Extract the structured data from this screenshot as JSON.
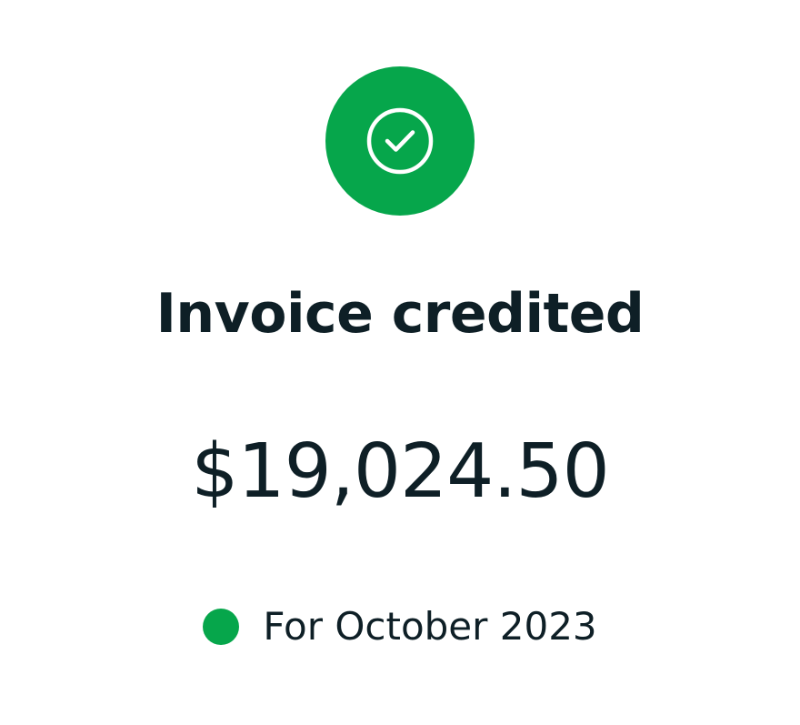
{
  "status": {
    "icon": "check-circle-icon",
    "color": "#06a64b"
  },
  "title": "Invoice credited",
  "amount": "$19,024.50",
  "period": {
    "label": "For October 2023",
    "dot_color": "#06a64b"
  },
  "colors": {
    "text": "#0e1f26",
    "background": "#ffffff"
  }
}
